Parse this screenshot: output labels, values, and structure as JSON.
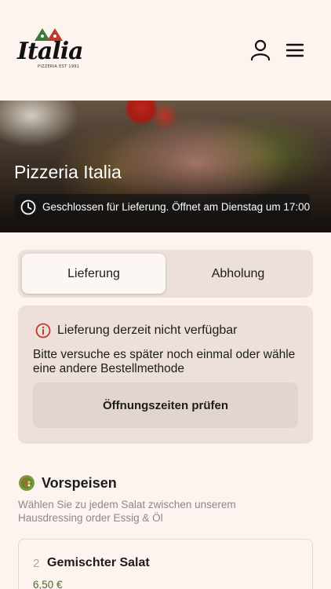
{
  "header": {
    "logo_text": "Italia",
    "logo_subtext": "PIZZERIA EST 1991",
    "user_icon": "user-icon",
    "menu_icon": "menu-icon"
  },
  "hero": {
    "title": "Pizzeria Italia",
    "status_icon": "clock-icon",
    "status_text": "Geschlossen für Lieferung. Öffnet am Dienstag um 17:00"
  },
  "order_mode": {
    "options": [
      "Lieferung",
      "Abholung"
    ],
    "selected": "Lieferung"
  },
  "notice": {
    "icon": "info-icon",
    "title": "Lieferung derzeit nicht verfügbar",
    "body": "Bitte versuche es später noch einmal oder wähle eine andere Bestellmethode",
    "button_label": "Öffnungszeiten prüfen"
  },
  "section": {
    "icon": "salad-icon",
    "title": "Vorspeisen",
    "description": "Wählen Sie zu jedem Salat zwischen unserem Hausdressing order Essig & Öl"
  },
  "items": [
    {
      "number": "2",
      "name": "Gemischter Salat",
      "price": "6,50 €"
    }
  ],
  "colors": {
    "background": "#fdf3ef",
    "panel": "#ede0db",
    "alert": "#c0392b",
    "price": "#4a6a2e"
  }
}
